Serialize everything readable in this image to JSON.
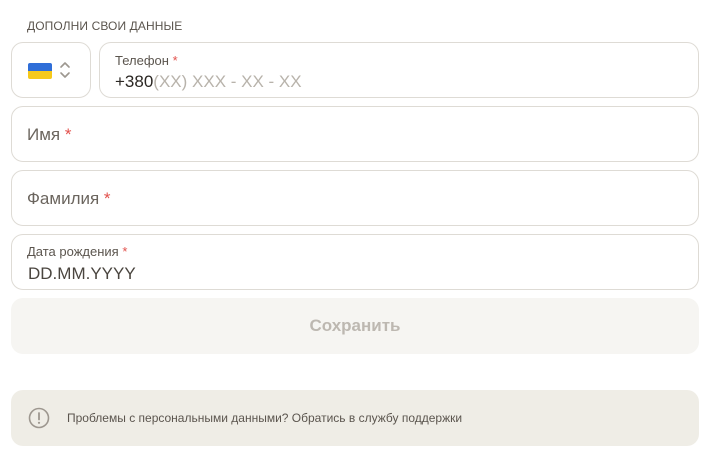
{
  "section": {
    "title": "ДОПОЛНИ СВОИ ДАННЫЕ"
  },
  "country": {
    "flag": "ukraine-flag",
    "icon": "chevron-up-down-icon"
  },
  "phone": {
    "label": "Телефон",
    "required": "*",
    "prefix": "+380",
    "mask": "(XX) XXX - XX - XX"
  },
  "first_name": {
    "label": "Имя",
    "required": "*"
  },
  "last_name": {
    "label": "Фамилия",
    "required": "*"
  },
  "birth_date": {
    "label": "Дата рождения",
    "required": "*",
    "placeholder": "DD.MM.YYYY"
  },
  "save_button": {
    "label": "Сохранить"
  },
  "support": {
    "icon": "info-icon",
    "text": "Проблемы с персональными данными? Обратись в службу поддержки"
  },
  "colors": {
    "required": "#e2514c",
    "support_bg": "#efede6",
    "button_bg": "#f6f5f2"
  }
}
